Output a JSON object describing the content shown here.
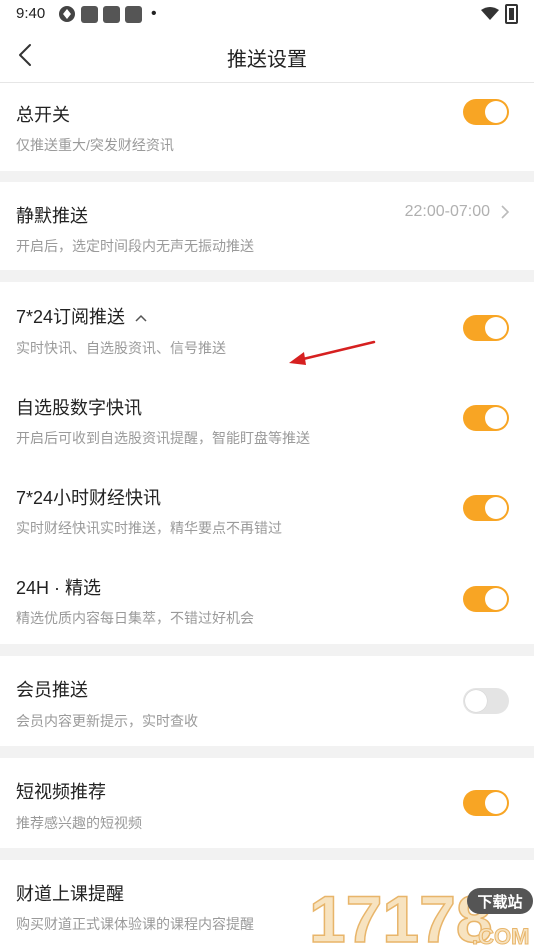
{
  "status_bar": {
    "time": "9:40",
    "icons": [
      "wifi-icon",
      "battery-icon",
      "app-icon",
      "notification-dot"
    ]
  },
  "header": {
    "title": "推送设置"
  },
  "settings": {
    "master_switch": {
      "title": "总开关",
      "subtitle": "仅推送重大/突发财经资讯",
      "enabled": true
    },
    "quiet_push": {
      "title": "静默推送",
      "subtitle": "开启后，选定时间段内无声无振动推送",
      "value": "22:00-07:00"
    },
    "subscription_7x24": {
      "title": "7*24订阅推送",
      "subtitle": "实时快讯、自选股资讯、信号推送",
      "enabled": true,
      "expanded": true
    },
    "watchlist_digital": {
      "title": "自选股数字快讯",
      "subtitle": "开启后可收到自选股资讯提醒，智能盯盘等推送",
      "enabled": true
    },
    "finance_7x24": {
      "title": "7*24小时财经快讯",
      "subtitle": "实时财经快讯实时推送，精华要点不再错过",
      "enabled": true
    },
    "selection_24h": {
      "title": "24H · 精选",
      "subtitle": "精选优质内容每日集萃，不错过好机会",
      "enabled": true
    },
    "member_push": {
      "title": "会员推送",
      "subtitle": "会员内容更新提示，实时查收",
      "enabled": false
    },
    "short_video": {
      "title": "短视频推荐",
      "subtitle": "推荐感兴趣的短视频",
      "enabled": true
    },
    "course_reminder": {
      "title": "财道上课提醒",
      "subtitle": "购买财道正式课体验课的课程内容提醒"
    }
  },
  "watermark": {
    "text": "17178",
    "domain": ".COM",
    "tag": "下载站"
  },
  "colors": {
    "accent": "#f8a524",
    "toggle_off": "#e4e4e4",
    "background": "#f2f2f2",
    "annotation_arrow": "#d62020"
  }
}
